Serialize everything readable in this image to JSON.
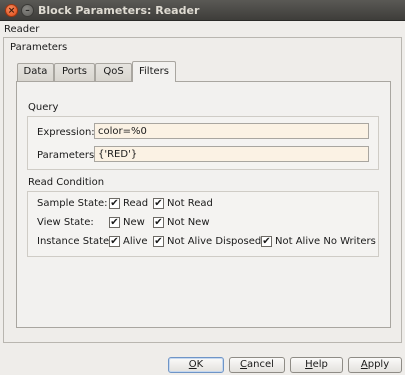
{
  "window": {
    "title": "Block Parameters: Reader",
    "close_glyph": "×",
    "minimize_glyph": "–"
  },
  "block_name": "Reader",
  "group_title": "Parameters",
  "tabs": [
    {
      "label": "Data",
      "active": false
    },
    {
      "label": "Ports",
      "active": false
    },
    {
      "label": "QoS",
      "active": false
    },
    {
      "label": "Filters",
      "active": true
    }
  ],
  "query": {
    "section_label": "Query",
    "expression_label": "Expression:",
    "expression_value": "color=%0",
    "parameters_label": "Parameters:",
    "parameters_value": "{'RED'}",
    "input_bg": "#fbf2e4"
  },
  "read_condition": {
    "section_label": "Read Condition",
    "rows": [
      {
        "label": "Sample State:",
        "options": [
          {
            "text": "Read",
            "checked": true
          },
          {
            "text": "Not Read",
            "checked": true
          }
        ]
      },
      {
        "label": "View State:",
        "options": [
          {
            "text": "New",
            "checked": true
          },
          {
            "text": "Not New",
            "checked": true
          }
        ]
      },
      {
        "label": "Instance State:",
        "options": [
          {
            "text": "Alive",
            "checked": true
          },
          {
            "text": "Not Alive Disposed",
            "checked": true
          },
          {
            "text": "Not Alive No Writers",
            "checked": true
          }
        ]
      }
    ]
  },
  "buttons": {
    "ok": {
      "mnemonic": "O",
      "rest": "K"
    },
    "cancel": {
      "mnemonic": "C",
      "rest": "ancel"
    },
    "help": {
      "mnemonic": "H",
      "rest": "elp"
    },
    "apply": {
      "mnemonic": "A",
      "rest": "pply"
    }
  },
  "check_glyph": "✔"
}
